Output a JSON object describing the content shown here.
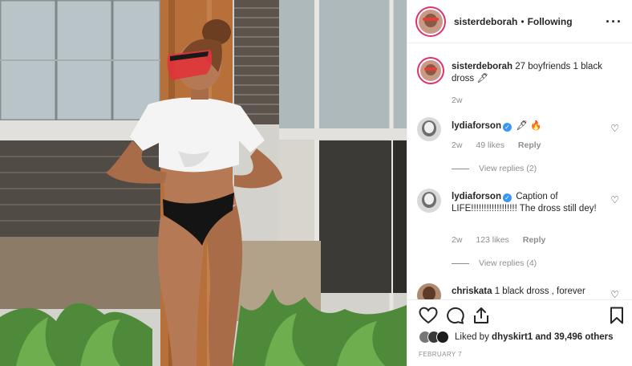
{
  "post": {
    "username": "sisterdeborah",
    "separator": "•",
    "follow_status": "Following",
    "more_icon": "more-icon",
    "caption": {
      "username": "sisterdeborah",
      "text": "27 boyfriends 1 black dross",
      "emoji": "🖋",
      "time": "2w"
    },
    "comments": [
      {
        "username": "lydiaforson",
        "verified": true,
        "text": "🖋 🔥",
        "time": "2w",
        "likes": "49 likes",
        "reply": "Reply",
        "view_replies": "View replies (2)"
      },
      {
        "username": "lydiaforson",
        "verified": true,
        "text": "Caption of LIFE!!!!!!!!!!!!!!!!!! The dross still dey!",
        "time": "2w",
        "likes": "123 likes",
        "reply": "Reply",
        "view_replies": "View replies (4)"
      },
      {
        "username": "chriskata",
        "verified": false,
        "text": "1 black dross , forever"
      }
    ],
    "liked_by": {
      "prefix": "Liked by",
      "user": "dhyskirt1",
      "suffix": "and 39,496 others"
    },
    "date": "FEBRUARY 7",
    "verified_glyph": "✓",
    "heart_glyph": "♡"
  }
}
